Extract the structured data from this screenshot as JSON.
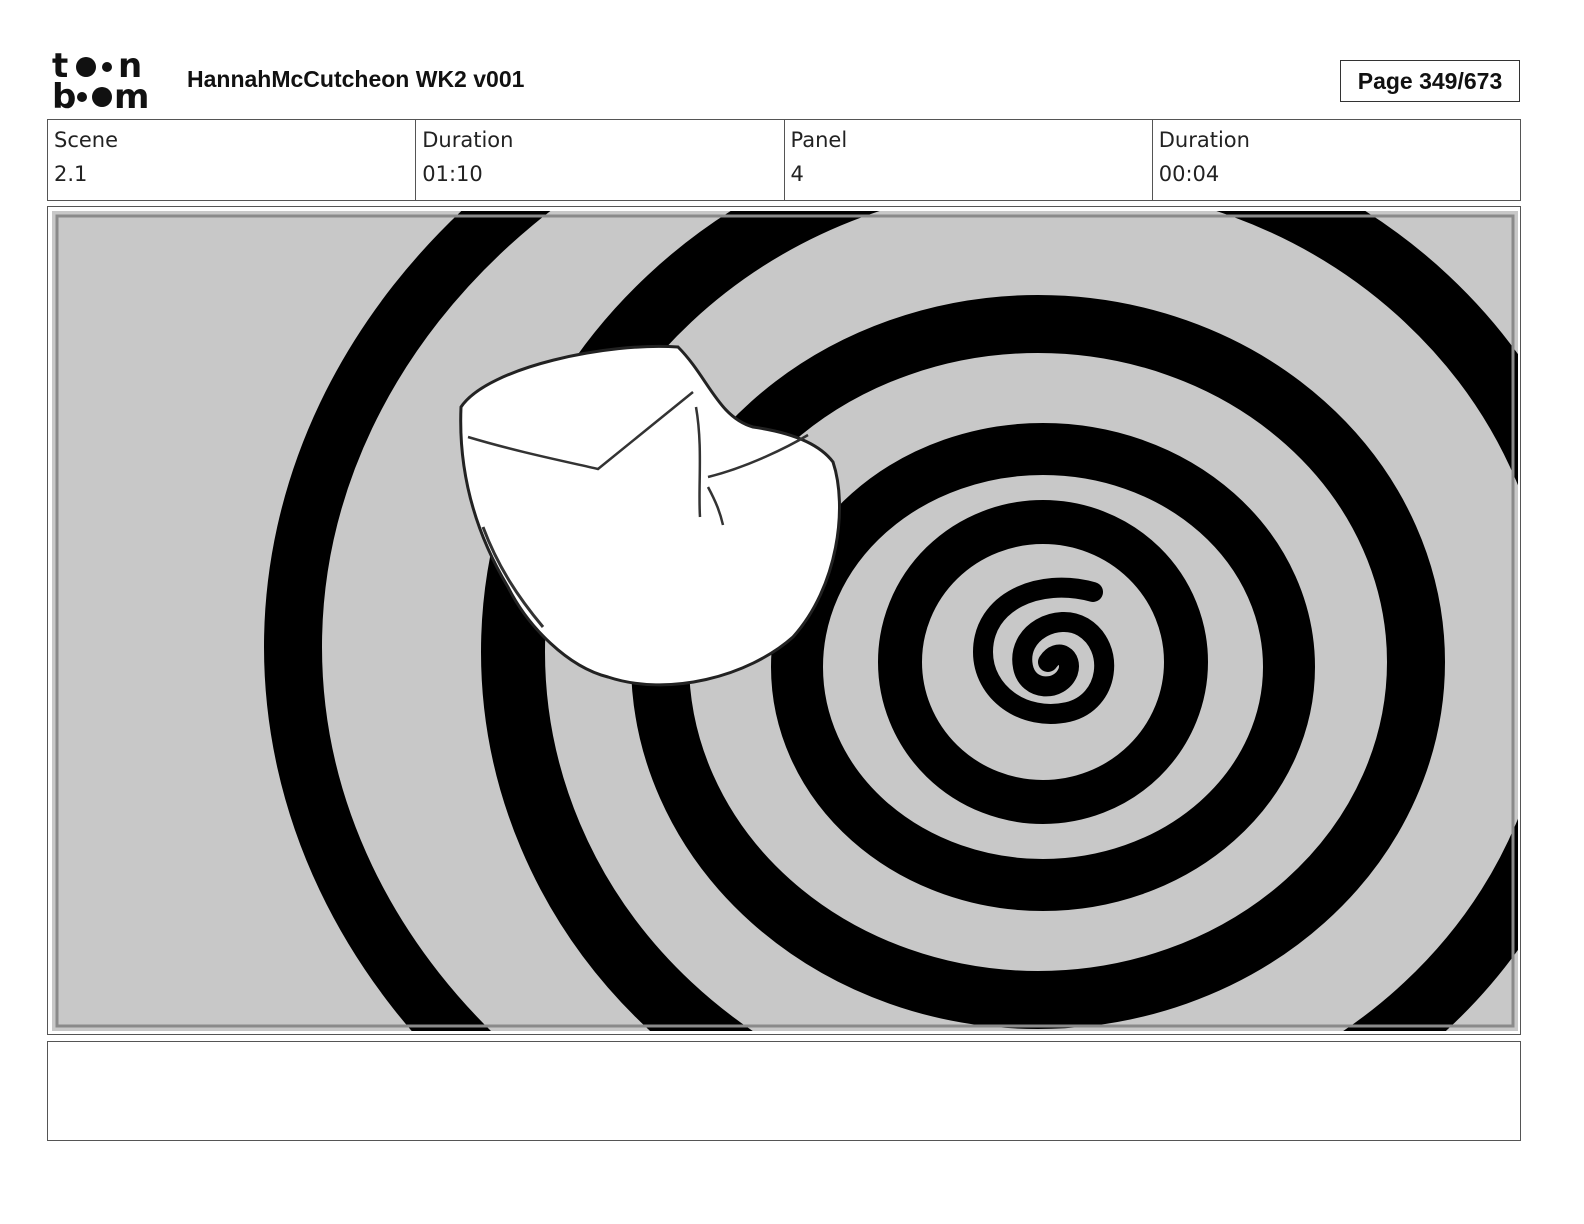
{
  "header": {
    "logo": {
      "line1": "to n",
      "line2": "b om",
      "name": "toon-boom-logo"
    },
    "title": "HannahMcCutcheon WK2 v001",
    "page": "Page 349/673"
  },
  "info": {
    "scene_label": "Scene",
    "scene_value": "2.1",
    "scene_duration_label": "Duration",
    "scene_duration_value": "01:10",
    "panel_label": "Panel",
    "panel_value": "4",
    "panel_duration_label": "Duration",
    "panel_duration_value": "00:04"
  },
  "panel": {
    "background_color": "#c8c8c8",
    "ink_color": "#000000",
    "object_color": "#ffffff"
  },
  "notes": {
    "text": ""
  }
}
